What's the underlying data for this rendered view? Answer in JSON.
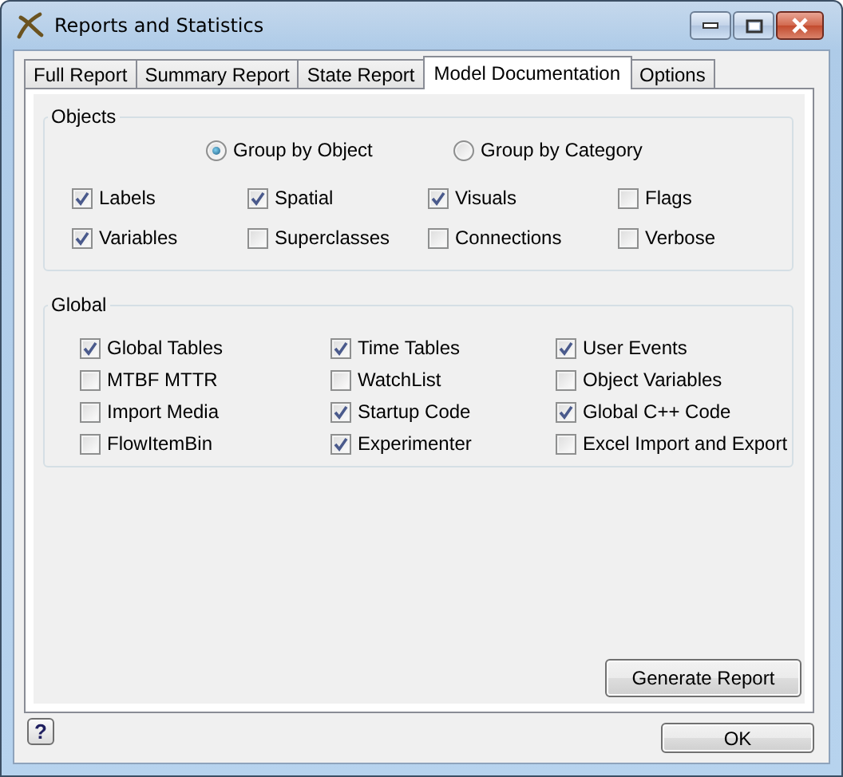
{
  "window": {
    "title": "Reports and Statistics"
  },
  "tabs": [
    {
      "label": "Full Report",
      "selected": false
    },
    {
      "label": "Summary Report",
      "selected": false
    },
    {
      "label": "State Report",
      "selected": false
    },
    {
      "label": "Model Documentation",
      "selected": true
    },
    {
      "label": "Options",
      "selected": false
    }
  ],
  "objects": {
    "title": "Objects",
    "grouping": [
      {
        "label": "Group by Object",
        "selected": true
      },
      {
        "label": "Group by Category",
        "selected": false
      }
    ],
    "options": [
      {
        "label": "Labels",
        "checked": true
      },
      {
        "label": "Spatial",
        "checked": true
      },
      {
        "label": "Visuals",
        "checked": true
      },
      {
        "label": "Flags",
        "checked": false
      },
      {
        "label": "Variables",
        "checked": true
      },
      {
        "label": "Superclasses",
        "checked": false
      },
      {
        "label": "Connections",
        "checked": false
      },
      {
        "label": "Verbose",
        "checked": false
      }
    ]
  },
  "global": {
    "title": "Global",
    "options": [
      {
        "label": "Global Tables",
        "checked": true
      },
      {
        "label": "Time Tables",
        "checked": true
      },
      {
        "label": "User Events",
        "checked": true
      },
      {
        "label": "MTBF MTTR",
        "checked": false
      },
      {
        "label": "WatchList",
        "checked": false
      },
      {
        "label": "Object Variables",
        "checked": false
      },
      {
        "label": "Import Media",
        "checked": false
      },
      {
        "label": "Startup Code",
        "checked": true
      },
      {
        "label": "Global C++ Code",
        "checked": true
      },
      {
        "label": "FlowItemBin",
        "checked": false
      },
      {
        "label": "Experimenter",
        "checked": true
      },
      {
        "label": "Excel Import and Export",
        "checked": false
      }
    ]
  },
  "generate_button": "Generate Report",
  "help_button": "?",
  "ok_button": "OK"
}
